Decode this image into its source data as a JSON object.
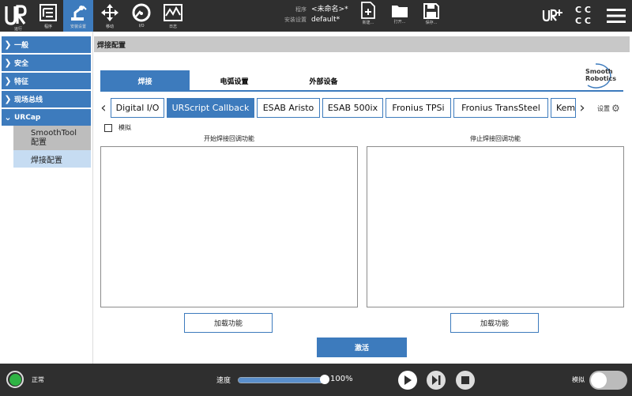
{
  "topbar": {
    "nav": [
      {
        "id": "run",
        "label": "运行"
      },
      {
        "id": "program",
        "label": "程序"
      },
      {
        "id": "install",
        "label": "安装设置"
      },
      {
        "id": "move",
        "label": "移动"
      },
      {
        "id": "io",
        "label": "I/O"
      },
      {
        "id": "log",
        "label": "日志"
      }
    ],
    "program_key": "程序",
    "program_value": "<未命名>*",
    "install_key": "安装设置",
    "install_value": "default*",
    "new_label": "新建...",
    "open_label": "打开...",
    "save_label": "保存...",
    "cc_top": "C C",
    "cc_bottom": "C C"
  },
  "sidebar": {
    "items": [
      {
        "label": "一般"
      },
      {
        "label": "安全"
      },
      {
        "label": "特征"
      },
      {
        "label": "现场总线"
      },
      {
        "label": "URCap"
      }
    ],
    "sub_items": [
      {
        "label": "SmoothTool 配置"
      },
      {
        "label": "焊接配置"
      }
    ]
  },
  "main": {
    "title": "焊接配置",
    "logo_line1": "Smooth",
    "logo_line2": "Robotics",
    "tabs": [
      {
        "label": "焊接"
      },
      {
        "label": "电弧设置"
      },
      {
        "label": "外部设备"
      }
    ],
    "subtabs": [
      {
        "label": "Digital I/O"
      },
      {
        "label": "URScript Callback"
      },
      {
        "label": "ESAB Aristo"
      },
      {
        "label": "ESAB 500ix"
      },
      {
        "label": "Fronius TPSi"
      },
      {
        "label": "Fronius TransSteel"
      },
      {
        "label": "Kemp"
      }
    ],
    "settings_label": "设置",
    "simulate_label": "模拟",
    "start_label": "开始焊接回调功能",
    "stop_label": "停止焊接回调功能",
    "load_label_left": "加载功能",
    "load_label_right": "加载功能",
    "activate_label": "激活"
  },
  "bottombar": {
    "status_label": "正常",
    "speed_label": "速度",
    "speed_value": "100%",
    "speed_fraction": 1.0,
    "mode_label": "模拟"
  },
  "colors": {
    "accent": "#3d7bbd",
    "dark": "#2f2f2f",
    "status_green": "#2fb344"
  }
}
